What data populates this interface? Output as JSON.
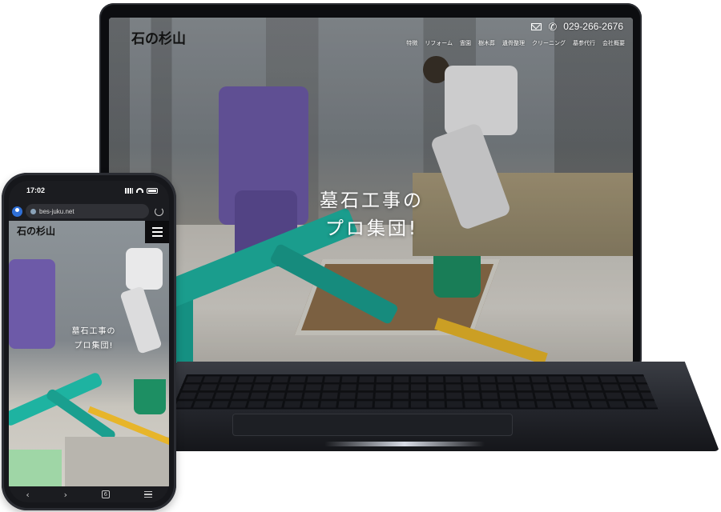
{
  "site": {
    "logo": "石の杉山",
    "phone": "029-266-2676",
    "nav": [
      "特徴",
      "リフォーム",
      "霊園",
      "樹木葬",
      "遺骨整理",
      "クリーニング",
      "墓参代行",
      "会社概要"
    ],
    "hero_line1": "墓石工事の",
    "hero_line2": "プロ集団!"
  },
  "phone": {
    "time": "17:02",
    "url": "bes-juku.net",
    "tab_count": "6"
  },
  "colors": {
    "machine": "#1eb3a1",
    "uniform": "#6d5aa8",
    "level": "#e7b52a"
  },
  "icons": [
    "mail-icon",
    "phone-icon",
    "hamburger-menu-icon",
    "reload-icon",
    "back-icon",
    "forward-icon",
    "tabs-icon",
    "menu-icon"
  ]
}
